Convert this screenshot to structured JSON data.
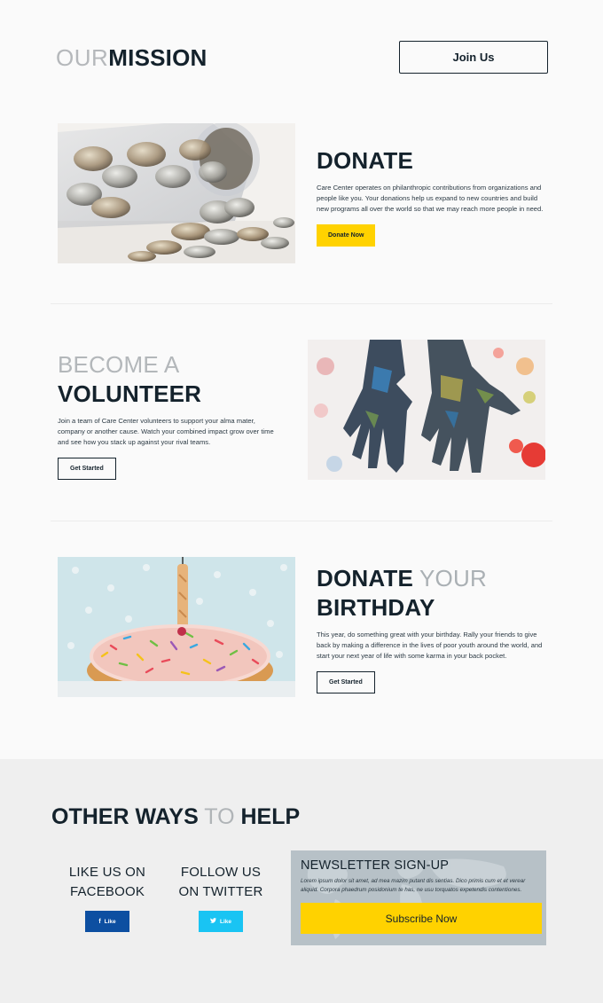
{
  "header": {
    "title_light": "OUR",
    "title_bold": "MISSION",
    "join_label": "Join Us"
  },
  "donate": {
    "title": "DONATE",
    "description": "Care Center operates on philanthropic contributions from organizations and people like you. Your donations help us expand to new countries and build new programs all over the world so that we may reach more people in need.",
    "button": "Donate Now"
  },
  "volunteer": {
    "title_light": "BECOME A",
    "title_bold": "VOLUNTEER",
    "description": "Join a team of Care Center volunteers to support your alma mater, company or another cause. Watch your combined impact grow over time and see how you stack up against your rival teams.",
    "button": "Get Started"
  },
  "birthday": {
    "title_bold_1": "DONATE",
    "title_light": "YOUR",
    "title_bold_2": "BIRTHDAY",
    "description": "This year, do something great with your birthday. Rally your friends to give back by making a difference in the lives of poor youth around the world, and start your next year of life with some karma in your back pocket.",
    "button": "Get Started"
  },
  "other": {
    "title_bold_1": "OTHER WAYS",
    "title_light": "TO",
    "title_bold_2": "HELP",
    "facebook": {
      "line1": "LIKE US ON",
      "line2": "FACEBOOK",
      "button": "Like"
    },
    "twitter": {
      "line1": "FOLLOW US",
      "line2": "ON TWITTER",
      "button": "Like"
    },
    "newsletter": {
      "title": "NEWSLETTER SIGN-UP",
      "text": "Lorem ipsum dolor sit amet, ad mea mazim putant dis sentias. Dico primis cum et et verear aliquid. Corpora phaedrum posidonium te has, ne usu torquatos expetendis contentiones.",
      "button": "Subscribe Now"
    }
  },
  "colors": {
    "accent_yellow": "#ffd200",
    "dark_navy": "#14222c",
    "facebook_blue": "#0d4fa1",
    "twitter_blue": "#19c4f3"
  }
}
